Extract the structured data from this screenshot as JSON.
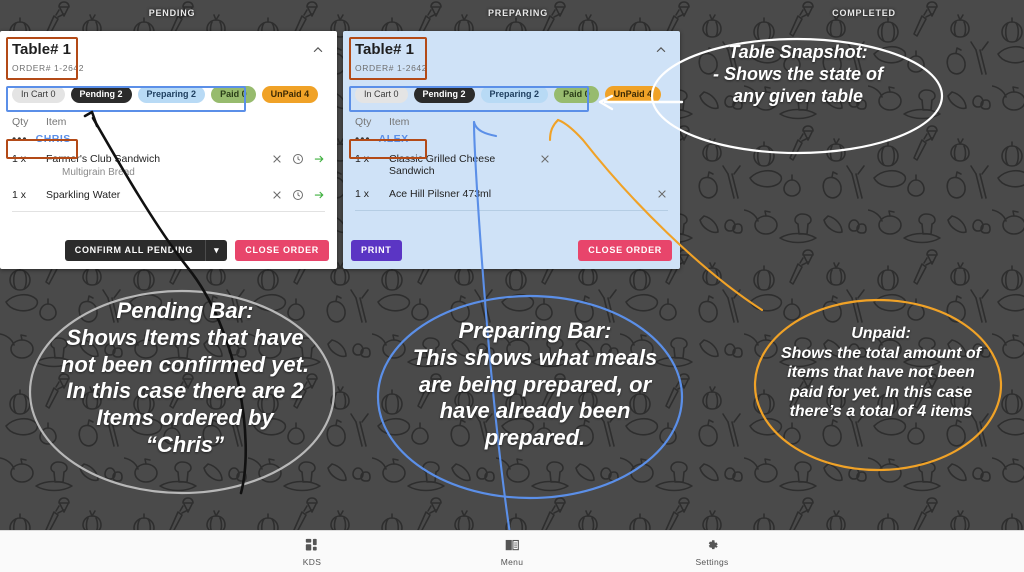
{
  "columns": [
    {
      "label": "PENDING"
    },
    {
      "label": "PREPARING"
    },
    {
      "label": "COMPLETED"
    }
  ],
  "cards": [
    {
      "id": "pending",
      "table_title": "Table# 1",
      "order_number": "ORDER# 1-2642",
      "collapse_icon": "chevron-up-icon",
      "chips": [
        {
          "label": "In Cart 0",
          "name": "chip-in-cart"
        },
        {
          "label": "Pending 2",
          "name": "chip-pending"
        },
        {
          "label": "Preparing 2",
          "name": "chip-preparing"
        },
        {
          "label": "Paid 0",
          "name": "chip-paid"
        },
        {
          "label": "UnPaid 4",
          "name": "chip-unpaid"
        }
      ],
      "table_headers": {
        "qty": "Qty",
        "item": "Item"
      },
      "guest": "CHRIS",
      "guest_menu_icon": "more-horizontal-icon",
      "items": [
        {
          "qty": "1 x",
          "name": "Farmer's Club Sandwich",
          "modifier": "Multigrain Bread"
        },
        {
          "qty": "1 x",
          "name": "Sparkling Water",
          "modifier": ""
        }
      ],
      "row_icons": [
        "close-icon",
        "clock-icon",
        "arrow-right-icon"
      ],
      "buttons": {
        "confirm": "CONFIRM ALL PENDING",
        "split_icon": "chevron-down-icon",
        "close_order": "CLOSE ORDER"
      }
    },
    {
      "id": "preparing",
      "table_title": "Table# 1",
      "order_number": "ORDER# 1-2642",
      "collapse_icon": "chevron-up-icon",
      "chips": [
        {
          "label": "In Cart 0",
          "name": "chip-in-cart"
        },
        {
          "label": "Pending 2",
          "name": "chip-pending"
        },
        {
          "label": "Preparing 2",
          "name": "chip-preparing"
        },
        {
          "label": "Paid 0",
          "name": "chip-paid"
        },
        {
          "label": "UnPaid 4",
          "name": "chip-unpaid"
        }
      ],
      "table_headers": {
        "qty": "Qty",
        "item": "Item"
      },
      "guest": "ALEX",
      "guest_menu_icon": "more-horizontal-icon",
      "items": [
        {
          "qty": "1 x",
          "name": "Classic Grilled Cheese Sandwich",
          "modifier": ""
        },
        {
          "qty": "1 x",
          "name": "Ace Hill Pilsner 473ml",
          "modifier": ""
        }
      ],
      "row_icons": [
        "close-icon"
      ],
      "buttons": {
        "print": "PRINT",
        "close_order": "CLOSE ORDER"
      }
    }
  ],
  "annotations": {
    "snapshot": "Table Snapshot:\n- Shows the state of\nany given table",
    "pending": "Pending Bar:\nShows Items that have\nnot been confirmed yet.\nIn this case there are 2\nItems ordered by\n“Chris”",
    "preparing": "Preparing Bar:\nThis shows what meals\nare being prepared, or\nhave already been\nprepared.",
    "unpaid": "Unpaid:\nShows the total amount of\nitems that have not been\npaid for yet. In this case\nthere’s a total of 4 items"
  },
  "bottom_nav": [
    {
      "label": "KDS",
      "icon": "dashboard-grid-icon"
    },
    {
      "label": "Menu",
      "icon": "book-menu-icon"
    },
    {
      "label": "Settings",
      "icon": "gear-icon"
    }
  ],
  "colors": {
    "background": "#4a4a4a",
    "pattern_line": "#2e2e2e",
    "card_pending_bg": "#ffffff",
    "card_preparing_bg": "#cfe2f7",
    "chip_pending": "#2b2b2b",
    "chip_preparing": "#b8daf5",
    "chip_paid": "#97bb6e",
    "chip_unpaid": "#f0a227",
    "btn_close_order": "#e8456b",
    "btn_print": "#5b35c4",
    "accent_green": "#3fb03f",
    "guest_name": "#5b8fe8",
    "annot_white": "#ffffff",
    "annot_gray": "#b8b8b8",
    "annot_blue": "#5b8fe8",
    "annot_orange": "#f0a227",
    "annot_box": "#b34a17"
  }
}
